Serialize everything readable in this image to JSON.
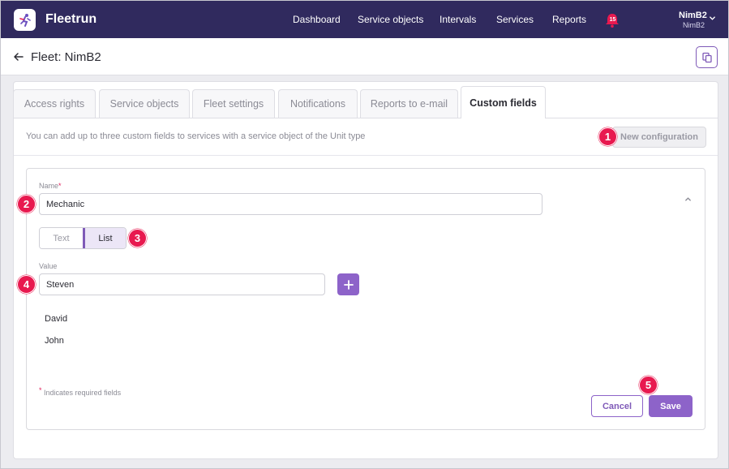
{
  "app": {
    "name": "Fleetrun"
  },
  "nav": {
    "items": [
      {
        "label": "Dashboard"
      },
      {
        "label": "Service objects"
      },
      {
        "label": "Intervals"
      },
      {
        "label": "Services"
      },
      {
        "label": "Reports"
      }
    ],
    "notifications_count": "15"
  },
  "user": {
    "name": "NimB2",
    "account": "NimB2"
  },
  "page": {
    "title": "Fleet: NimB2"
  },
  "tabs": [
    {
      "label": "Access rights"
    },
    {
      "label": "Service objects"
    },
    {
      "label": "Fleet settings"
    },
    {
      "label": "Notifications"
    },
    {
      "label": "Reports to e-mail"
    },
    {
      "label": "Custom fields",
      "active": true
    }
  ],
  "info": {
    "text": "You can add up to three custom fields to services with a service object of the Unit type",
    "new_config_label": "New configuration"
  },
  "form": {
    "name_label": "Name",
    "name_value": "Mechanic",
    "type_options": [
      "Text",
      "List"
    ],
    "type_selected": "List",
    "value_label": "Value",
    "value_input": "Steven",
    "list_values": [
      "David",
      "John"
    ],
    "required_note": "Indicates required fields",
    "cancel_label": "Cancel",
    "save_label": "Save"
  },
  "markers": [
    "1",
    "2",
    "3",
    "4",
    "5"
  ],
  "colors": {
    "topbar": "#302a5e",
    "accent": "#8d63c9",
    "marker": "#e8194f"
  }
}
